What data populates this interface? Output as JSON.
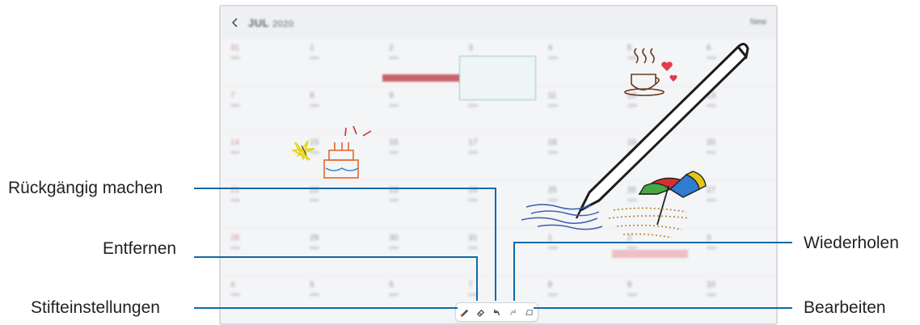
{
  "app": {
    "title": "JUL",
    "title_suffix": "2020",
    "new_label": "New"
  },
  "calendar": {
    "days": [
      "31",
      "1",
      "2",
      "3",
      "4",
      "5",
      "6",
      "7",
      "8",
      "9",
      "10",
      "11",
      "12",
      "13",
      "14",
      "15",
      "16",
      "17",
      "18",
      "19",
      "20",
      "21",
      "22",
      "23",
      "24",
      "25",
      "26",
      "27",
      "28",
      "29",
      "30",
      "31",
      "1",
      "2",
      "3",
      "4",
      "5",
      "6",
      "7",
      "8",
      "9",
      "10"
    ]
  },
  "toolbar": {
    "buttons": [
      "pen-settings-icon",
      "eraser-icon",
      "undo-icon",
      "redo-icon",
      "edit-icon"
    ]
  },
  "callouts": {
    "undo": "Rückgängig machen",
    "erase": "Entfernen",
    "pen_settings": "Stifteinstellungen",
    "redo": "Wiederholen",
    "edit": "Bearbeiten"
  },
  "colors": {
    "callout_line": "#0e6aa8",
    "event_red": "#c9636a",
    "event_pink": "#ecc0c4"
  }
}
